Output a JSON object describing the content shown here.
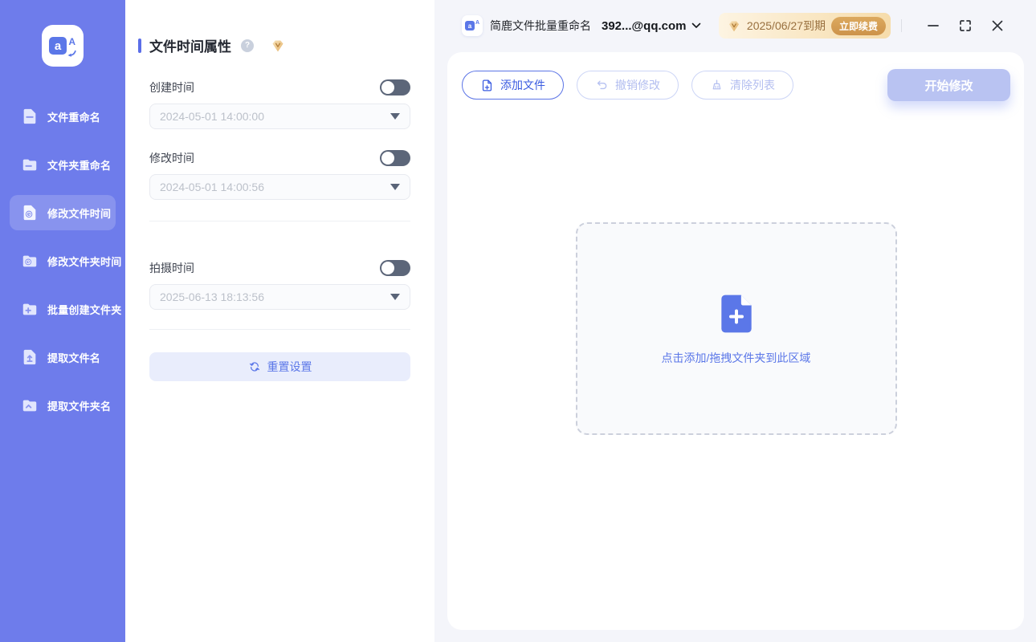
{
  "colors": {
    "sidebar_bg": "#6e7ceb",
    "accent": "#5b77e8",
    "primary_disabled": "#b9c3f2",
    "toggle_off": "#5c6679",
    "vip_text": "#99703f"
  },
  "app_logo": {
    "letter_a": "a",
    "letter_A": "A"
  },
  "sidebar": {
    "items": [
      {
        "label": "文件重命名",
        "icon": "file-icon",
        "selected": false
      },
      {
        "label": "文件夹重命名",
        "icon": "folder-icon",
        "selected": false
      },
      {
        "label": "修改文件时间",
        "icon": "file-clock-icon",
        "selected": true
      },
      {
        "label": "修改文件夹时间",
        "icon": "folder-clock-icon",
        "selected": false
      },
      {
        "label": "批量创建文件夹",
        "icon": "folder-plus-icon",
        "selected": false
      },
      {
        "label": "提取文件名",
        "icon": "file-upload-icon",
        "selected": false
      },
      {
        "label": "提取文件夹名",
        "icon": "folder-upload-icon",
        "selected": false
      }
    ]
  },
  "settings_panel": {
    "title": "文件时间属性",
    "help_glyph": "?",
    "fields": [
      {
        "label": "创建时间",
        "value": "2024-05-01 14:00:00",
        "enabled": false
      },
      {
        "label": "修改时间",
        "value": "2024-05-01 14:00:56",
        "enabled": false
      },
      {
        "label": "拍摄时间",
        "value": "2025-06-13 18:13:56",
        "enabled": false
      }
    ],
    "reset_label": "重置设置"
  },
  "titlebar": {
    "app_title": "简鹿文件批量重命名",
    "account": "392...@qq.com",
    "license_expiry": "2025/06/27到期",
    "renew_label": "立即续费"
  },
  "toolbar": {
    "add_label": "添加文件",
    "undo_label": "撤销修改",
    "clear_label": "清除列表",
    "start_label": "开始修改"
  },
  "dropzone": {
    "hint": "点击添加/拖拽文件夹到此区域"
  }
}
